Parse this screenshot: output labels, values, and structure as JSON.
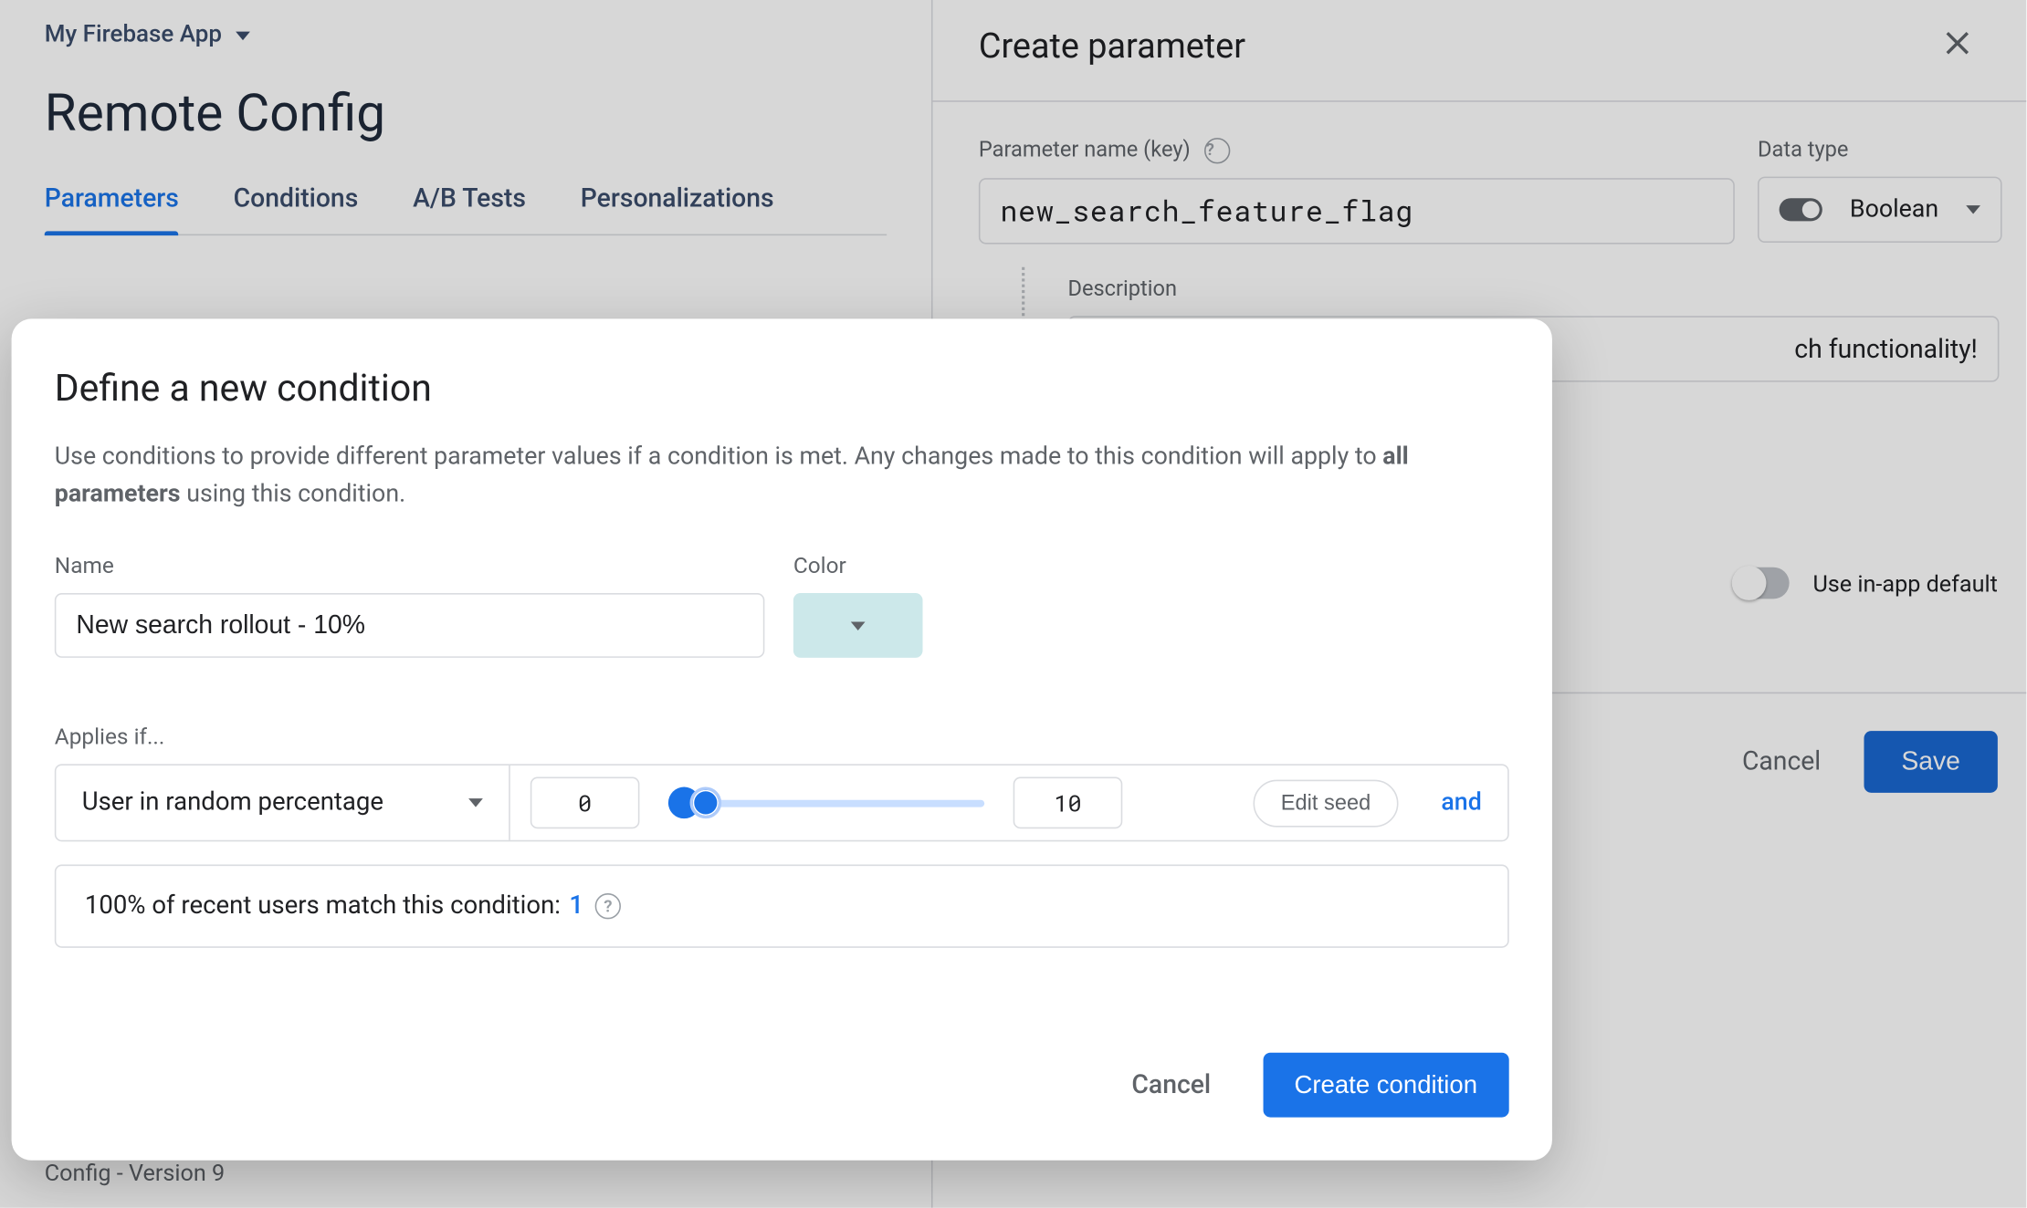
{
  "project_name": "My Firebase App",
  "page_title": "Remote Config",
  "tabs": {
    "parameters": "Parameters",
    "conditions": "Conditions",
    "ab_tests": "A/B Tests",
    "personalizations": "Personalizations"
  },
  "config_version": "Config - Version 9",
  "side": {
    "title": "Create parameter",
    "param_label": "Parameter name (key)",
    "param_value": "new_search_feature_flag",
    "data_type_label": "Data type",
    "data_type_value": "Boolean",
    "desc_label": "Description",
    "desc_value_visible": "ch functionality!",
    "use_inapp_default": "Use in-app default",
    "cancel": "Cancel",
    "save": "Save"
  },
  "dialog": {
    "title": "Define a new condition",
    "desc_pre": "Use conditions to provide different parameter values if a condition is met. Any changes made to this condition will apply to ",
    "desc_bold": "all parameters",
    "desc_post": " using this condition.",
    "name_label": "Name",
    "name_value": "New search rollout - 10%",
    "color_label": "Color",
    "color_value": "#cce8ea",
    "applies_if_label": "Applies if...",
    "condition_type": "User in random percentage",
    "range_low": "0",
    "range_high": "10",
    "edit_seed": "Edit seed",
    "and": "and",
    "match_text": "100% of recent users match this condition: ",
    "match_count": "1",
    "cancel": "Cancel",
    "create": "Create condition"
  }
}
